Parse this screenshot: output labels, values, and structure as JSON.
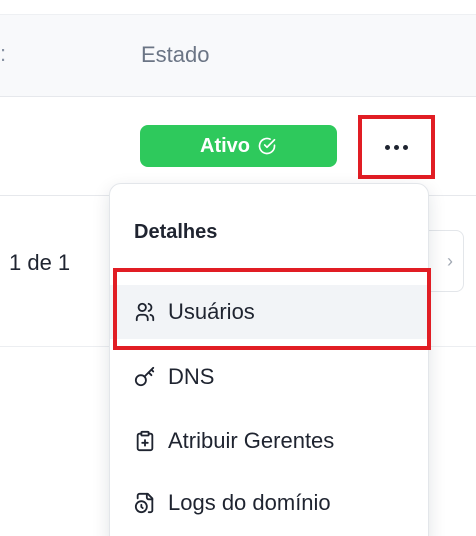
{
  "table": {
    "header_prev": ":",
    "header_status": "Estado"
  },
  "row": {
    "status": "Ativo",
    "status_color": "#2ec95c"
  },
  "pagination": {
    "text": "1 de 1",
    "next_glyph": "›"
  },
  "menu": {
    "heading": "Detalhes",
    "items": [
      {
        "label": "Usuários",
        "icon": "users-icon"
      },
      {
        "label": "DNS",
        "icon": "key-icon"
      },
      {
        "label": "Atribuir Gerentes",
        "icon": "clipboard-plus-icon"
      },
      {
        "label": "Logs do domínio",
        "icon": "file-clock-icon"
      }
    ]
  },
  "highlight_color": "#e11d24"
}
